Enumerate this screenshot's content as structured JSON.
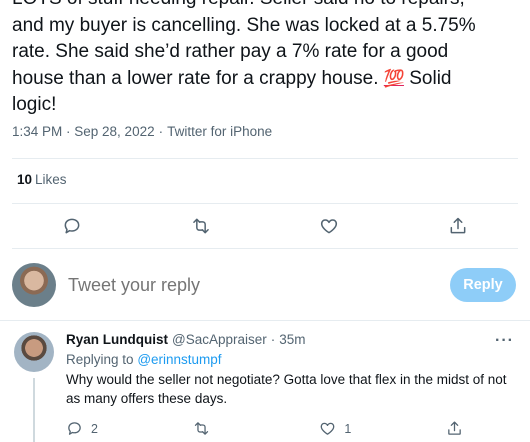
{
  "tweet": {
    "text_lines": [
      "LOTS of stuff needing repair. Seller said no to repairs,",
      "and my buyer is cancelling. She was locked at a 5.75%",
      "rate. She said she’d rather pay a 7% rate for a good",
      "house than a lower rate for a crappy house."
    ],
    "emoji": "💯",
    "text_tail": " Solid",
    "text_last": "logic!",
    "time": "1:34 PM · Sep 28, 2022",
    "separator": "·",
    "source": "Twitter for iPhone",
    "likes_count": "10",
    "likes_label": "Likes"
  },
  "actions_main": {
    "icons": [
      "reply-icon",
      "retweet-icon",
      "like-icon",
      "share-icon"
    ]
  },
  "compose": {
    "placeholder": "Tweet your reply",
    "reply_label": "Reply"
  },
  "reply": {
    "name": "Ryan Lundquist",
    "handle": "@SacAppraiser",
    "dot": "·",
    "time": "35m",
    "more": "···",
    "replying_prefix": "Replying to",
    "replying_to": "@erinnstumpf",
    "text": "Why would the seller not negotiate? Gotta love that flex in the midst of not as many offers these days.",
    "counts": {
      "replies": "2",
      "retweets": "",
      "likes": "1",
      "share": ""
    }
  },
  "colors": {
    "text": "#0f1419",
    "secondary": "#536471",
    "accent": "#1d9bf0",
    "reply_button_disabled": "#8ecdf8",
    "divider": "#e6ecf0"
  }
}
